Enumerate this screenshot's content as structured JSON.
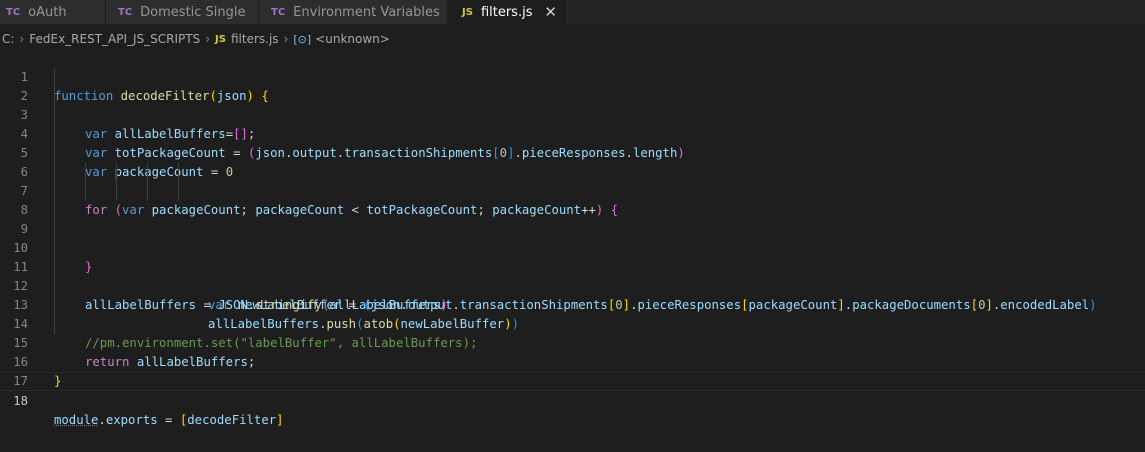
{
  "tabs": [
    {
      "icon": "TC",
      "label": "oAuth"
    },
    {
      "icon": "TC",
      "label": "Domestic Single"
    },
    {
      "icon": "TC",
      "label": "Environment Variables"
    },
    {
      "icon": "JS",
      "label": "filters.js",
      "close": "✕"
    }
  ],
  "breadcrumb": {
    "root": "C:",
    "folder": "FedEx_REST_API_JS_SCRIPTS",
    "file_icon": "JS",
    "file": "filters.js",
    "symbol_icon": "[⊙]",
    "symbol": "<unknown>"
  },
  "line_numbers": [
    "1",
    "2",
    "3",
    "4",
    "5",
    "6",
    "7",
    "8",
    "9",
    "10",
    "11",
    "12",
    "13",
    "14",
    "15",
    "16",
    "17",
    "18"
  ],
  "code": {
    "l1": [
      "function",
      " ",
      "decodeFilter",
      "(",
      "json",
      ")",
      " ",
      "{"
    ],
    "l2": [
      "var",
      " ",
      "allLabelBuffers",
      "=",
      "[",
      "]",
      ";"
    ],
    "l3": [
      "var",
      " ",
      "totPackageCount",
      " = ",
      "(",
      "json",
      ".",
      "output",
      ".",
      "transactionShipments",
      "[",
      "0",
      "]",
      ".",
      "pieceResponses",
      ".",
      "length",
      ")"
    ],
    "l4": [
      "var",
      " ",
      "packageCount",
      " = ",
      "0"
    ],
    "l6": [
      "for",
      " ",
      "(",
      "var",
      " ",
      "packageCount",
      "; ",
      "packageCount",
      " < ",
      "totPackageCount",
      "; ",
      "packageCount",
      "++",
      ") ",
      "{"
    ],
    "l7": [
      "var",
      " ",
      "newLabelBuffer",
      " = ",
      "(",
      "json",
      ".",
      "output",
      ".",
      "transactionShipments",
      "[",
      "0",
      "]",
      ".",
      "pieceResponses",
      "[",
      "packageCount",
      "]",
      ".",
      "packageDocuments",
      "[",
      "0",
      "]",
      ".",
      "encodedLabel",
      ")"
    ],
    "l8": [
      "allLabelBuffers",
      ".",
      "push",
      "(",
      "atob",
      "(",
      "newLabelBuffer",
      ")",
      ")"
    ],
    "l10": [
      "}"
    ],
    "l11": [
      "allLabelBuffers",
      " = ",
      "JSON",
      ".",
      "stringify",
      "(",
      "allLabelBuffers",
      ")"
    ],
    "l13": [
      "//pm.environment.set(\"labelBuffer\", allLabelBuffers);"
    ],
    "l14": [
      "return",
      " ",
      "allLabelBuffers",
      ";"
    ],
    "l16": [
      "}"
    ],
    "l18": [
      "module",
      ".",
      "exports",
      " = ",
      "[",
      "decodeFilter",
      "]"
    ]
  },
  "colors": {
    "background": "#1e1e1e",
    "keyword": "#569cd6",
    "control": "#c586c0",
    "function": "#dcdcaa",
    "variable": "#9cdcfe",
    "number": "#b5cea8",
    "comment": "#6a9955"
  },
  "current_line": "18"
}
